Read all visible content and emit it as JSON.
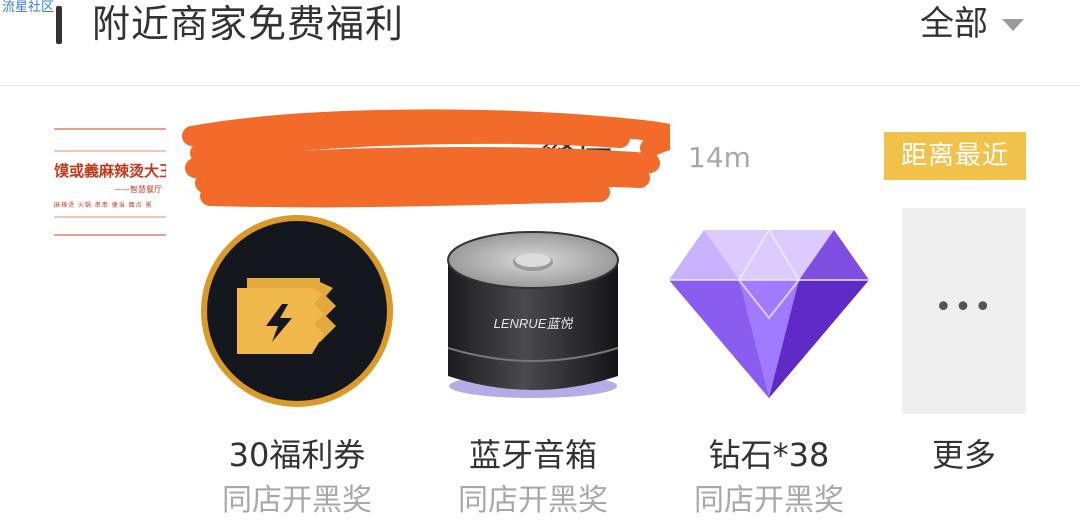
{
  "watermark": "流星社区",
  "header": {
    "title": "附近商家免费福利",
    "filter_label": "全部"
  },
  "store": {
    "logo": {
      "name_text": "馍或義麻辣烫大王",
      "sub_text": "——智慧餐厅",
      "tags_text": "麻辣烫  火锅  串串  便当  面点  粥"
    },
    "name_visible": "餐厅",
    "distance": "14m",
    "tag": "距离最近",
    "tag_color": "#f0c24a",
    "scribble_color": "#f26b2a"
  },
  "rewards": [
    {
      "title": "30福利券",
      "subtitle": "同店开黑奖",
      "icon": "lightning-ticket-icon"
    },
    {
      "title": "蓝牙音箱",
      "subtitle": "同店开黑奖",
      "icon": "bluetooth-speaker-image",
      "brand": "LENRUE蓝悦"
    },
    {
      "title": "钻石*38",
      "subtitle": "同店开黑奖",
      "icon": "purple-diamond-image"
    }
  ],
  "more": {
    "dots": "•••",
    "label": "更多"
  }
}
